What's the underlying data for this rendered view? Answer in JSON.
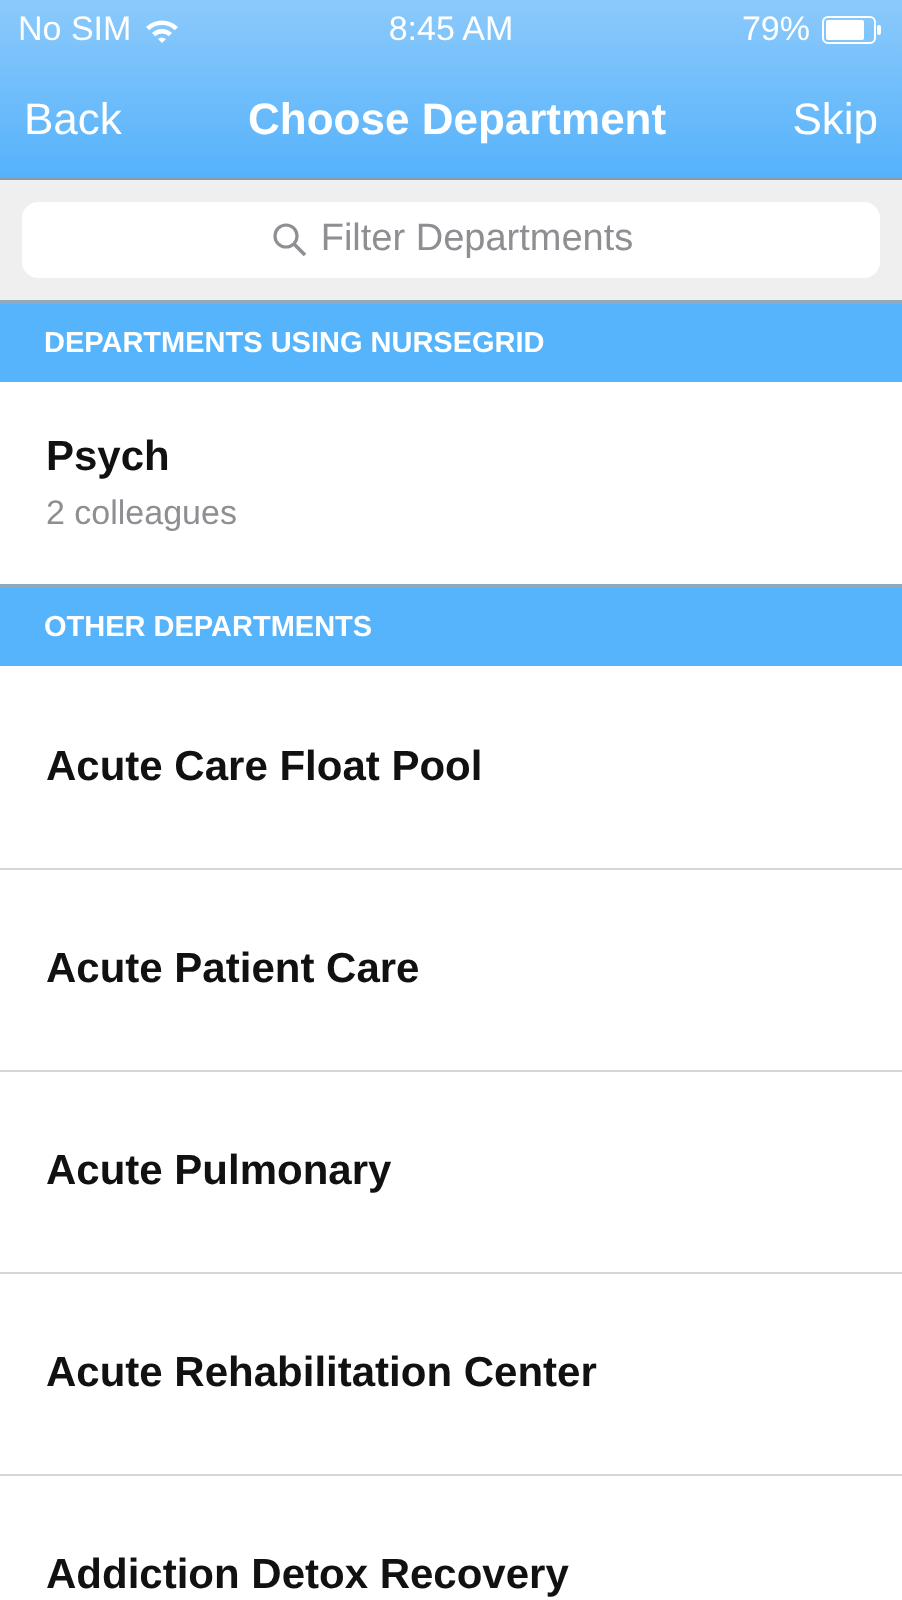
{
  "status_bar": {
    "carrier": "No SIM",
    "time": "8:45 AM",
    "battery": "79%"
  },
  "nav": {
    "back": "Back",
    "title": "Choose Department",
    "skip": "Skip"
  },
  "search": {
    "placeholder": "Filter Departments"
  },
  "sections": [
    {
      "header": "DEPARTMENTS USING NURSEGRID",
      "items": [
        {
          "name": "Psych",
          "subtitle": "2 colleagues"
        }
      ]
    },
    {
      "header": "OTHER DEPARTMENTS",
      "items": [
        {
          "name": "Acute Care Float Pool"
        },
        {
          "name": "Acute Patient Care"
        },
        {
          "name": "Acute Pulmonary"
        },
        {
          "name": "Acute Rehabilitation Center"
        },
        {
          "name": "Addiction Detox Recovery"
        }
      ]
    }
  ]
}
